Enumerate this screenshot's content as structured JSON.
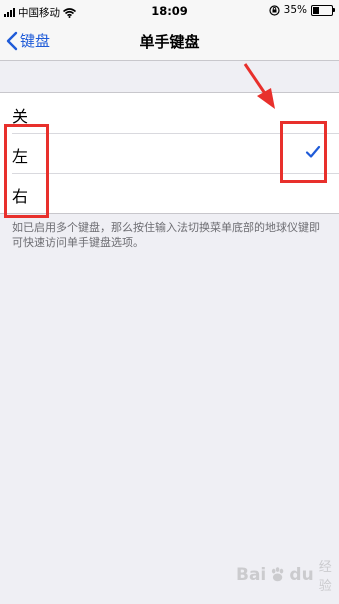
{
  "status_bar": {
    "carrier": "中国移动",
    "time": "18:09",
    "battery_percent_text": "35%",
    "battery_level": 0.35
  },
  "nav": {
    "back_label": "键盘",
    "title": "单手键盘"
  },
  "options": [
    {
      "label": "关",
      "selected": false
    },
    {
      "label": "左",
      "selected": true
    },
    {
      "label": "右",
      "selected": false
    }
  ],
  "footer_note": "如已启用多个键盘，那么按住输入法切换菜单底部的地球仪键即可快速访问单手键盘选项。",
  "watermark": {
    "brand": "Bai",
    "brand_end": "du",
    "suffix": "经验"
  },
  "colors": {
    "accent": "#1f5bd8",
    "annotation": "#e8302c",
    "background": "#efeff4"
  },
  "icons": [
    "signal-icon",
    "wifi-icon",
    "rotation-lock-icon",
    "battery-icon",
    "chevron-left-icon",
    "checkmark-icon",
    "annotation-arrow",
    "baidu-paw-icon"
  ]
}
